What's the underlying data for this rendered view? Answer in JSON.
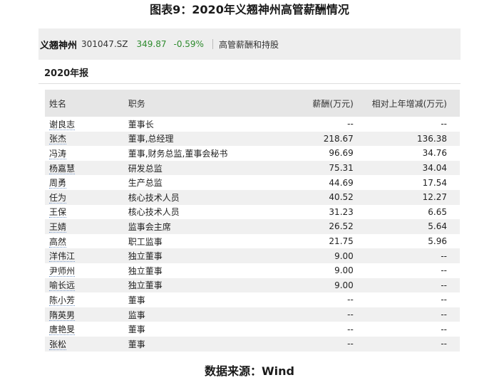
{
  "figure_title": "图表9：2020年义翘神州高管薪酬情况",
  "stock": {
    "name": "义翘神州",
    "code": "301047.SZ",
    "price": "349.87",
    "change": "-0.59%",
    "link": "高管薪酬和持股"
  },
  "year_heading": "2020年报",
  "table": {
    "headers": [
      "姓名",
      "职务",
      "薪酬(万元)",
      "相对上年增减(万元)"
    ],
    "rows": [
      {
        "name": "谢良志",
        "role": "董事长",
        "salary": "--",
        "change": "--"
      },
      {
        "name": "张杰",
        "role": "董事,总经理",
        "salary": "218.67",
        "change": "136.38"
      },
      {
        "name": "冯涛",
        "role": "董事,财务总监,董事会秘书",
        "salary": "96.69",
        "change": "34.76"
      },
      {
        "name": "杨嘉慧",
        "role": "研发总监",
        "salary": "75.31",
        "change": "34.04"
      },
      {
        "name": "周勇",
        "role": "生产总监",
        "salary": "44.69",
        "change": "17.54"
      },
      {
        "name": "任为",
        "role": "核心技术人员",
        "salary": "40.52",
        "change": "12.27"
      },
      {
        "name": "王保",
        "role": "核心技术人员",
        "salary": "31.23",
        "change": "6.65"
      },
      {
        "name": "王婧",
        "role": "监事会主席",
        "salary": "26.52",
        "change": "5.64"
      },
      {
        "name": "高然",
        "role": "职工监事",
        "salary": "21.75",
        "change": "5.96"
      },
      {
        "name": "洋伟江",
        "role": "独立董事",
        "salary": "9.00",
        "change": "--"
      },
      {
        "name": "尹师州",
        "role": "独立董事",
        "salary": "9.00",
        "change": "--"
      },
      {
        "name": "喻长远",
        "role": "独立董事",
        "salary": "9.00",
        "change": "--"
      },
      {
        "name": "陈小芳",
        "role": "董事",
        "salary": "--",
        "change": "--"
      },
      {
        "name": "隋英男",
        "role": "监事",
        "salary": "--",
        "change": "--"
      },
      {
        "name": "唐艳旻",
        "role": "董事",
        "salary": "--",
        "change": "--"
      },
      {
        "name": "张松",
        "role": "董事",
        "salary": "--",
        "change": "--"
      }
    ]
  },
  "footer": "数据来源：Wind"
}
